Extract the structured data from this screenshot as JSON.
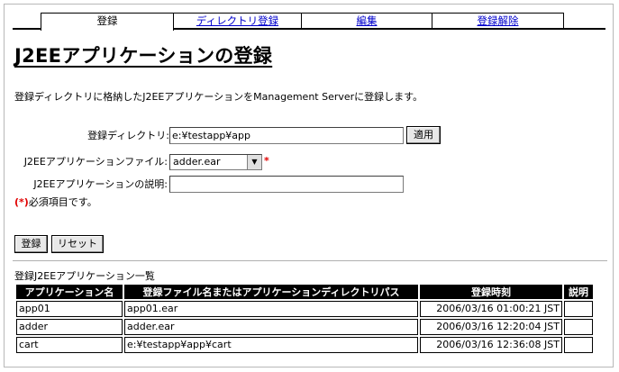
{
  "tabs": [
    "登録",
    "ディレクトリ登録",
    "編集",
    "登録解除"
  ],
  "page_title": "J2EEアプリケーションの登録",
  "description": "登録ディレクトリに格納したJ2EEアプリケーションをManagement Serverに登録します。",
  "form": {
    "dir_label": "登録ディレクトリ:",
    "dir_value": "e:¥testapp¥app",
    "apply_label": "適用",
    "file_label": "J2EEアプリケーションファイル:",
    "file_value": "adder.ear",
    "required_mark": "*",
    "desc_label": "J2EEアプリケーションの説明:",
    "desc_value": "",
    "required_note_mark": "(*)",
    "required_note_text": "必須項目です。",
    "submit_label": "登録",
    "reset_label": "リセット"
  },
  "table": {
    "title": "登録J2EEアプリケーション一覧",
    "headers": [
      "アプリケーション名",
      "登録ファイル名またはアプリケーションディレクトリパス",
      "登録時刻",
      "説明"
    ],
    "rows": [
      [
        "app01",
        "app01.ear",
        "2006/03/16 01:00:21  JST",
        ""
      ],
      [
        "adder",
        "adder.ear",
        "2006/03/16 12:20:04  JST",
        ""
      ],
      [
        "cart",
        "e:¥testapp¥app¥cart",
        "2006/03/16 12:36:08  JST",
        ""
      ]
    ]
  }
}
